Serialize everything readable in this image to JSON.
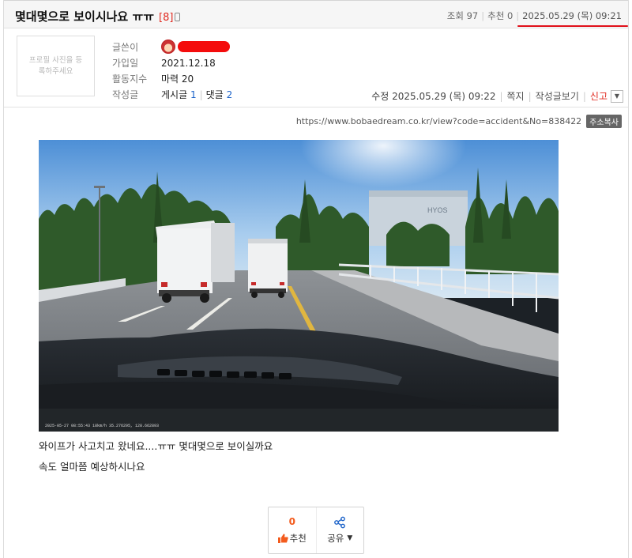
{
  "post": {
    "title": "몇대몇으로 보이시나요 ㅠㅠ",
    "reply_count": "[8]",
    "views_label": "조회 97",
    "recommend_label": "추천 0",
    "date": "2025.05.29 (목) 09:21"
  },
  "profile": {
    "photo_placeholder": "프로필 사진을 등록하주세요",
    "writer_label": "글쓴이",
    "joined_label": "가입일",
    "joined_value": "2021.12.18",
    "activity_label": "활동지수",
    "activity_value": "마력 20",
    "posts_label": "작성글",
    "posts_text": "게시글",
    "posts_count": "1",
    "comments_text": "댓글",
    "comments_count": "2"
  },
  "actions": {
    "edited": "수정 2025.05.29 (목) 09:22",
    "message": "쪽지",
    "view_posts": "작성글보기",
    "report": "신고"
  },
  "url": {
    "text": "https://www.bobaedream.co.kr/view?code=accident&No=838422",
    "copy_label": "주소복사"
  },
  "image": {
    "sign_text": "HYOS",
    "dashcam_overlay": "2025-05-27  08:55:43     18km/h    35.276295, 128.662893"
  },
  "body": {
    "line1": "와이프가 사고치고 왔네요....ㅠㅠ 몇대몇으로 보이실까요",
    "line2": "속도 얼마쯤 예상하시나요"
  },
  "vote": {
    "count": "0",
    "recommend": "추천",
    "share": "공유"
  },
  "colors": {
    "accent_red": "#e0291f",
    "link_blue": "#1b62c9",
    "vote_orange": "#f35b1d"
  }
}
